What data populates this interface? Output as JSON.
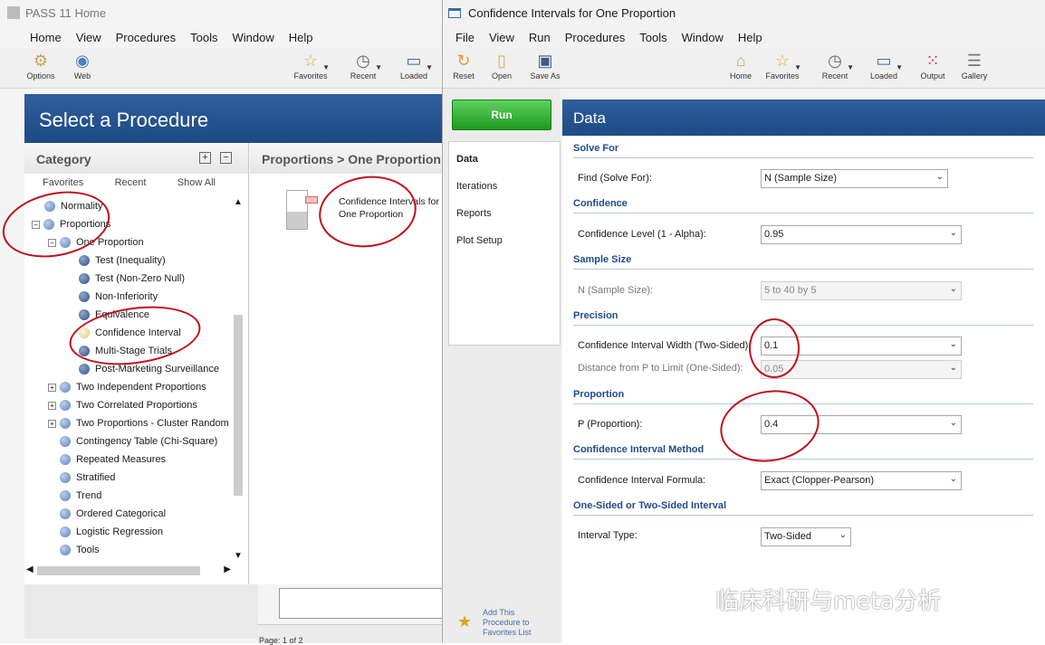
{
  "back_window": {
    "title": "PASS 11 Home",
    "menu": [
      "Home",
      "View",
      "Procedures",
      "Tools",
      "Window",
      "Help"
    ],
    "toolbar": [
      "Options",
      "Web",
      "Favorites",
      "Recent",
      "Loaded"
    ],
    "banner": "Select a Procedure",
    "category": {
      "header": "Category",
      "plus": "+",
      "minus": "−",
      "subtabs": [
        "Favorites",
        "Recent",
        "Show All"
      ],
      "items": [
        "Normality",
        "Proportions",
        "One Proportion",
        "Test (Inequality)",
        "Test (Non-Zero Null)",
        "Non-Inferiority",
        "Equivalence",
        "Confidence Interval",
        "Multi-Stage Trials",
        "Post-Marketing Surveillance",
        "Two Independent Proportions",
        "Two Correlated Proportions",
        "Two Proportions - Cluster Random",
        "Contingency Table (Chi-Square)",
        "Repeated Measures",
        "Stratified",
        "Trend",
        "Ordered Categorical",
        "Logistic Regression",
        "Tools"
      ]
    },
    "procedures": {
      "header": "Proportions > One Proportion",
      "item": "Confidence Intervals for One Proportion"
    },
    "page_status": "Page: 1 of 2"
  },
  "front_window": {
    "title": "Confidence Intervals for One Proportion",
    "menu": [
      "File",
      "View",
      "Run",
      "Procedures",
      "Tools",
      "Window",
      "Help"
    ],
    "toolbar_left": [
      "Reset",
      "Open",
      "Save As"
    ],
    "toolbar_right": [
      "Home",
      "Favorites",
      "Recent",
      "Loaded",
      "Output",
      "Gallery"
    ],
    "run_label": "Run",
    "tabs": [
      "Data",
      "Iterations",
      "Reports",
      "Plot Setup"
    ],
    "add_favorites": [
      "Add This",
      "Procedure to",
      "Favorites List"
    ],
    "panel_title": "Data",
    "sections": {
      "solve_for": "Solve For",
      "confidence": "Confidence",
      "sample_size": "Sample Size",
      "precision": "Precision",
      "proportion": "Proportion",
      "ci_method": "Confidence Interval Method",
      "interval": "One-Sided or Two-Sided Interval"
    },
    "fields": {
      "find_label": "Find (Solve For):",
      "find_value": "N (Sample Size)",
      "conf_label": "Confidence Level (1 - Alpha):",
      "conf_value": "0.95",
      "n_label": "N (Sample Size):",
      "n_value": "5 to 40 by 5",
      "width_label": "Confidence Interval Width (Two-Sided):",
      "width_value": "0.1",
      "dist_label": "Distance from P to Limit (One-Sided):",
      "dist_value": "0.05",
      "p_label": "P (Proportion):",
      "p_value": "0.4",
      "formula_label": "Confidence Interval Formula:",
      "formula_value": "Exact (Clopper-Pearson)",
      "type_label": "Interval Type:",
      "type_value": "Two-Sided"
    }
  },
  "watermark": "临床科研与meta分析",
  "colors": {
    "banner": "#1e4a85",
    "run": "#1f9a1f",
    "section": "#1f4b8c",
    "annotation": "#c0101a"
  }
}
